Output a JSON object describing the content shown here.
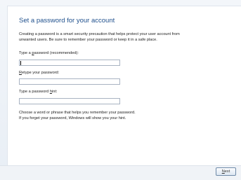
{
  "dialog": {
    "title": "Set a password for your account",
    "intro_line1": "Creating a password is a smart security precaution that helps protect your user account from",
    "intro_line2": "unwanted users. Be sure to remember your password or keep it in a safe place."
  },
  "fields": {
    "password": {
      "label_pre": "Type a ",
      "label_accel": "p",
      "label_post": "assword (recommended):",
      "value": ""
    },
    "retype": {
      "label_pre": "",
      "label_accel": "R",
      "label_post": "etype your password:",
      "value": ""
    },
    "hint": {
      "label_pre": "Type a password ",
      "label_accel": "h",
      "label_post": "int:",
      "value": ""
    }
  },
  "hint_help": {
    "line1": "Choose a word or phrase that helps you remember your password.",
    "line2": "If you forget your password, Windows will show you your hint."
  },
  "buttons": {
    "next_accel": "N",
    "next_rest": "ext"
  }
}
